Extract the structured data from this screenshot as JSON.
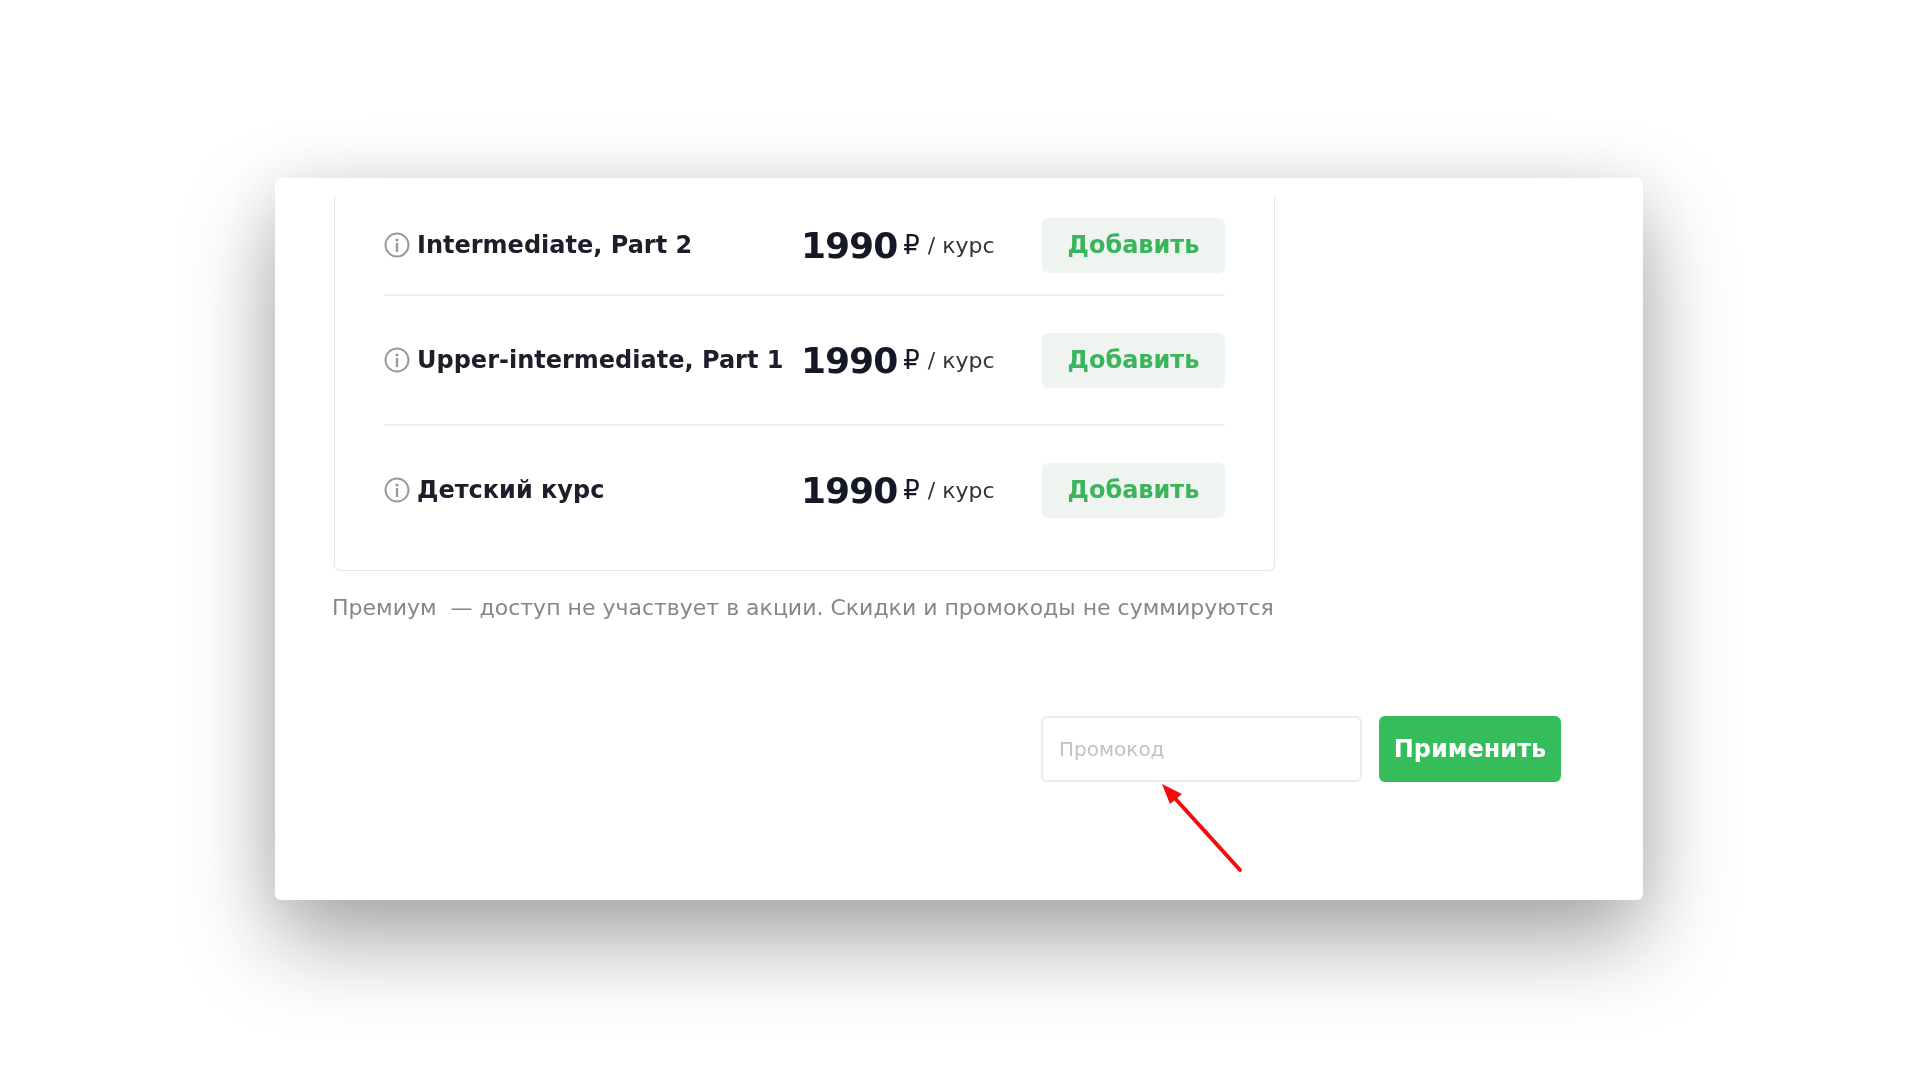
{
  "courses": [
    {
      "title": "Intermediate, Part 2",
      "price": "1990",
      "currency": "₽",
      "unit": "/ курс",
      "button": "Добавить"
    },
    {
      "title": "Upper-intermediate, Part 1",
      "price": "1990",
      "currency": "₽",
      "unit": "/ курс",
      "button": "Добавить"
    },
    {
      "title": "Детский курс",
      "price": "1990",
      "currency": "₽",
      "unit": "/ курс",
      "button": "Добавить"
    }
  ],
  "note": "Премиум  — доступ не участвует в акции. Скидки и промокоды не суммируются",
  "promo": {
    "placeholder": "Промокод",
    "button": "Применить"
  }
}
